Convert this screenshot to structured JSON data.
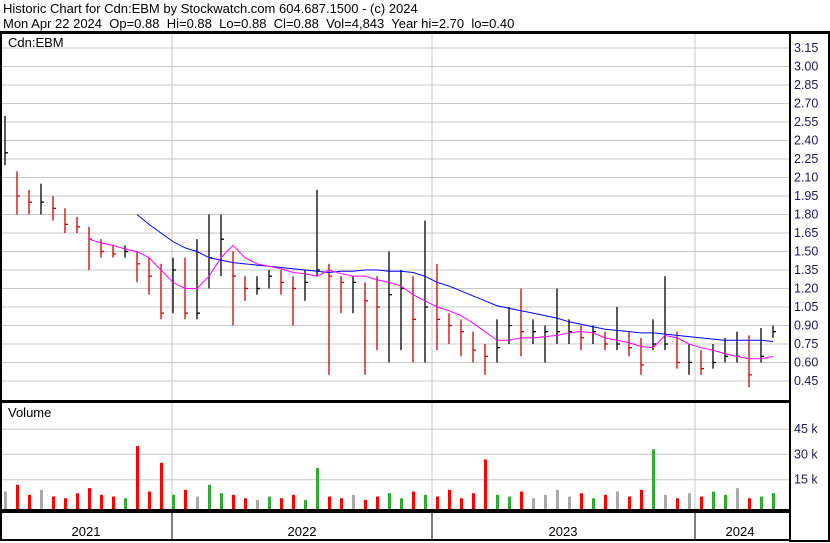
{
  "header": {
    "title": "Historic Chart for Cdn:EBM by Stockwatch.com 604.687.1500 - (c) 2024",
    "quote": "Mon Apr 22 2024  Op=0.88  Hi=0.88  Lo=0.88  Cl=0.88  Vol=4,843  Year hi=2.70  lo=0.40"
  },
  "colors": {
    "up": "#000000",
    "down": "#d00000",
    "ma_long": "#0000ff",
    "ma_short": "#ff00ff",
    "vol_up": "#33aa33",
    "vol_down": "#ff0000",
    "vol_flat": "#aaaaaa",
    "grid": "#c8c8c8"
  },
  "chart_data": {
    "type": "line",
    "symbol_label": "Cdn:EBM",
    "volume_label": "Volume",
    "price_ticks": [
      "3.15",
      "3.00",
      "2.85",
      "2.70",
      "2.55",
      "2.40",
      "2.25",
      "2.10",
      "1.95",
      "1.80",
      "1.65",
      "1.50",
      "1.35",
      "1.20",
      "1.05",
      "0.90",
      "0.75",
      "0.60",
      "0.45"
    ],
    "price_ylim": [
      0.4,
      3.25
    ],
    "volume_ticks": [
      "45 k",
      "30 k",
      "15 k"
    ],
    "volume_ylim": [
      0,
      50
    ],
    "year_labels": [
      "2021",
      "2022",
      "2023",
      "2024"
    ],
    "close": [
      2.3,
      1.95,
      1.9,
      1.9,
      1.85,
      1.72,
      1.7,
      1.6,
      1.5,
      1.48,
      1.5,
      1.4,
      1.3,
      1.0,
      1.35,
      1.0,
      1.0,
      1.45,
      1.6,
      1.3,
      1.2,
      1.2,
      1.3,
      1.25,
      1.2,
      1.25,
      1.35,
      1.3,
      1.25,
      1.25,
      1.1,
      1.05,
      1.15,
      1.2,
      0.95,
      1.05,
      0.95,
      0.9,
      0.85,
      0.7,
      0.65,
      0.72,
      0.9,
      0.85,
      0.85,
      0.85,
      0.85,
      0.85,
      0.8,
      0.85,
      0.75,
      0.75,
      0.72,
      0.58,
      0.75,
      0.75,
      0.6,
      0.6,
      0.55,
      0.6,
      0.65,
      0.65,
      0.5,
      0.65,
      0.85
    ],
    "high": [
      2.6,
      2.15,
      2.0,
      2.05,
      1.95,
      1.85,
      1.78,
      1.7,
      1.6,
      1.55,
      1.55,
      1.5,
      1.45,
      1.4,
      1.45,
      1.45,
      1.6,
      1.8,
      1.8,
      1.5,
      1.3,
      1.3,
      1.35,
      1.35,
      1.3,
      1.35,
      2.0,
      1.4,
      1.3,
      1.3,
      1.25,
      1.3,
      1.5,
      1.35,
      1.3,
      1.75,
      1.4,
      1.0,
      0.95,
      0.85,
      0.75,
      0.95,
      1.05,
      1.2,
      0.95,
      0.9,
      1.2,
      0.95,
      0.9,
      0.9,
      0.85,
      1.05,
      0.85,
      0.8,
      0.95,
      1.3,
      0.85,
      0.75,
      0.7,
      0.75,
      0.8,
      0.85,
      0.82,
      0.88,
      0.9
    ],
    "low": [
      2.2,
      1.8,
      1.8,
      1.8,
      1.75,
      1.65,
      1.65,
      1.35,
      1.45,
      1.45,
      1.45,
      1.25,
      1.15,
      0.95,
      1.0,
      0.95,
      0.95,
      1.2,
      1.3,
      0.9,
      1.1,
      1.15,
      1.2,
      1.15,
      0.9,
      1.1,
      1.3,
      0.5,
      1.0,
      1.0,
      0.5,
      0.7,
      0.6,
      0.7,
      0.6,
      0.6,
      0.7,
      0.75,
      0.65,
      0.6,
      0.5,
      0.6,
      0.75,
      0.65,
      0.75,
      0.6,
      0.75,
      0.75,
      0.7,
      0.75,
      0.7,
      0.7,
      0.65,
      0.5,
      0.7,
      0.7,
      0.55,
      0.5,
      0.5,
      0.55,
      0.6,
      0.6,
      0.4,
      0.6,
      0.8
    ],
    "series": [
      {
        "name": "MA long",
        "values": [
          null,
          null,
          null,
          null,
          null,
          null,
          null,
          null,
          null,
          null,
          null,
          1.8,
          1.72,
          1.65,
          1.58,
          1.53,
          1.5,
          1.45,
          1.43,
          1.41,
          1.4,
          1.39,
          1.38,
          1.37,
          1.36,
          1.35,
          1.34,
          1.33,
          1.34,
          1.34,
          1.35,
          1.35,
          1.34,
          1.34,
          1.33,
          1.3,
          1.25,
          1.22,
          1.18,
          1.14,
          1.1,
          1.06,
          1.04,
          1.02,
          1.0,
          0.98,
          0.96,
          0.93,
          0.91,
          0.89,
          0.87,
          0.86,
          0.85,
          0.84,
          0.84,
          0.83,
          0.82,
          0.81,
          0.8,
          0.79,
          0.78,
          0.78,
          0.78,
          0.78,
          0.77
        ]
      },
      {
        "name": "MA short",
        "values": [
          null,
          null,
          null,
          null,
          null,
          null,
          null,
          1.6,
          1.57,
          1.55,
          1.52,
          1.5,
          1.45,
          1.35,
          1.25,
          1.2,
          1.2,
          1.3,
          1.45,
          1.55,
          1.45,
          1.4,
          1.38,
          1.36,
          1.33,
          1.32,
          1.3,
          1.35,
          1.32,
          1.3,
          1.3,
          1.27,
          1.25,
          1.22,
          1.15,
          1.1,
          1.05,
          1.02,
          0.98,
          0.92,
          0.85,
          0.78,
          0.78,
          0.8,
          0.8,
          0.81,
          0.82,
          0.84,
          0.85,
          0.84,
          0.8,
          0.78,
          0.76,
          0.73,
          0.72,
          0.82,
          0.8,
          0.75,
          0.72,
          0.7,
          0.67,
          0.65,
          0.63,
          0.63,
          0.65
        ]
      }
    ],
    "volume_k": [
      8,
      12,
      6,
      9,
      5,
      4,
      7,
      10,
      6,
      5,
      4,
      35,
      8,
      25,
      6,
      9,
      5,
      12,
      7,
      6,
      4,
      3,
      5,
      4,
      6,
      3,
      22,
      5,
      4,
      6,
      3,
      5,
      7,
      4,
      8,
      6,
      5,
      9,
      4,
      7,
      27,
      6,
      5,
      8,
      4,
      6,
      9,
      5,
      7,
      4,
      6,
      8,
      5,
      9,
      33,
      6,
      4,
      7,
      5,
      8,
      6,
      10,
      4,
      5,
      7
    ]
  }
}
